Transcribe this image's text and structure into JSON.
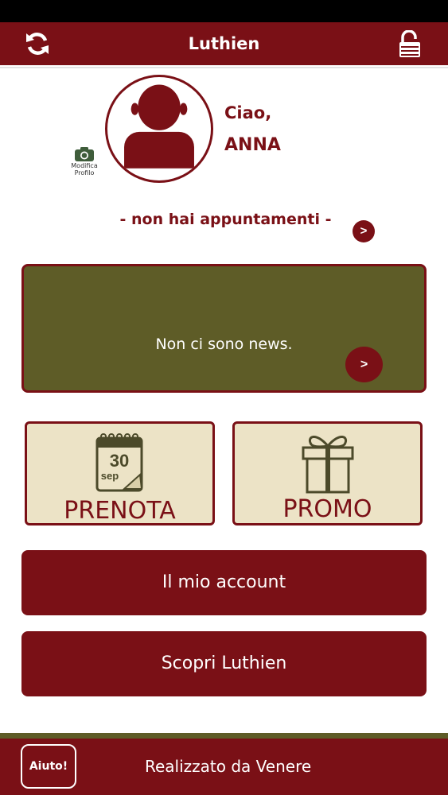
{
  "header": {
    "title": "Luthien",
    "refresh_icon": "refresh-icon",
    "lock_icon": "lock-open-icon"
  },
  "profile": {
    "greeting": "Ciao,",
    "name": "ANNA",
    "edit_label_line1": "Modifica",
    "edit_label_line2": "Profilo",
    "avatar_icon": "user-silhouette-icon",
    "camera_icon": "camera-icon"
  },
  "appointments": {
    "text": "- non hai appuntamenti -",
    "arrow_label": ">"
  },
  "news": {
    "text": "Non ci sono news.",
    "arrow_label": ">"
  },
  "tiles": {
    "prenota": {
      "label": "PRENOTA",
      "calendar_day": "30",
      "calendar_month": "sep",
      "icon": "calendar-icon"
    },
    "promo": {
      "label": "PROMO",
      "icon": "gift-icon"
    }
  },
  "buttons": {
    "account": "Il mio account",
    "scopri": "Scopri Luthien"
  },
  "footer": {
    "help": "Aiuto!",
    "credit": "Realizzato da Venere"
  },
  "colors": {
    "primary": "#7a1016",
    "olive": "#5e5c27",
    "tile_bg": "#ece3c6"
  }
}
